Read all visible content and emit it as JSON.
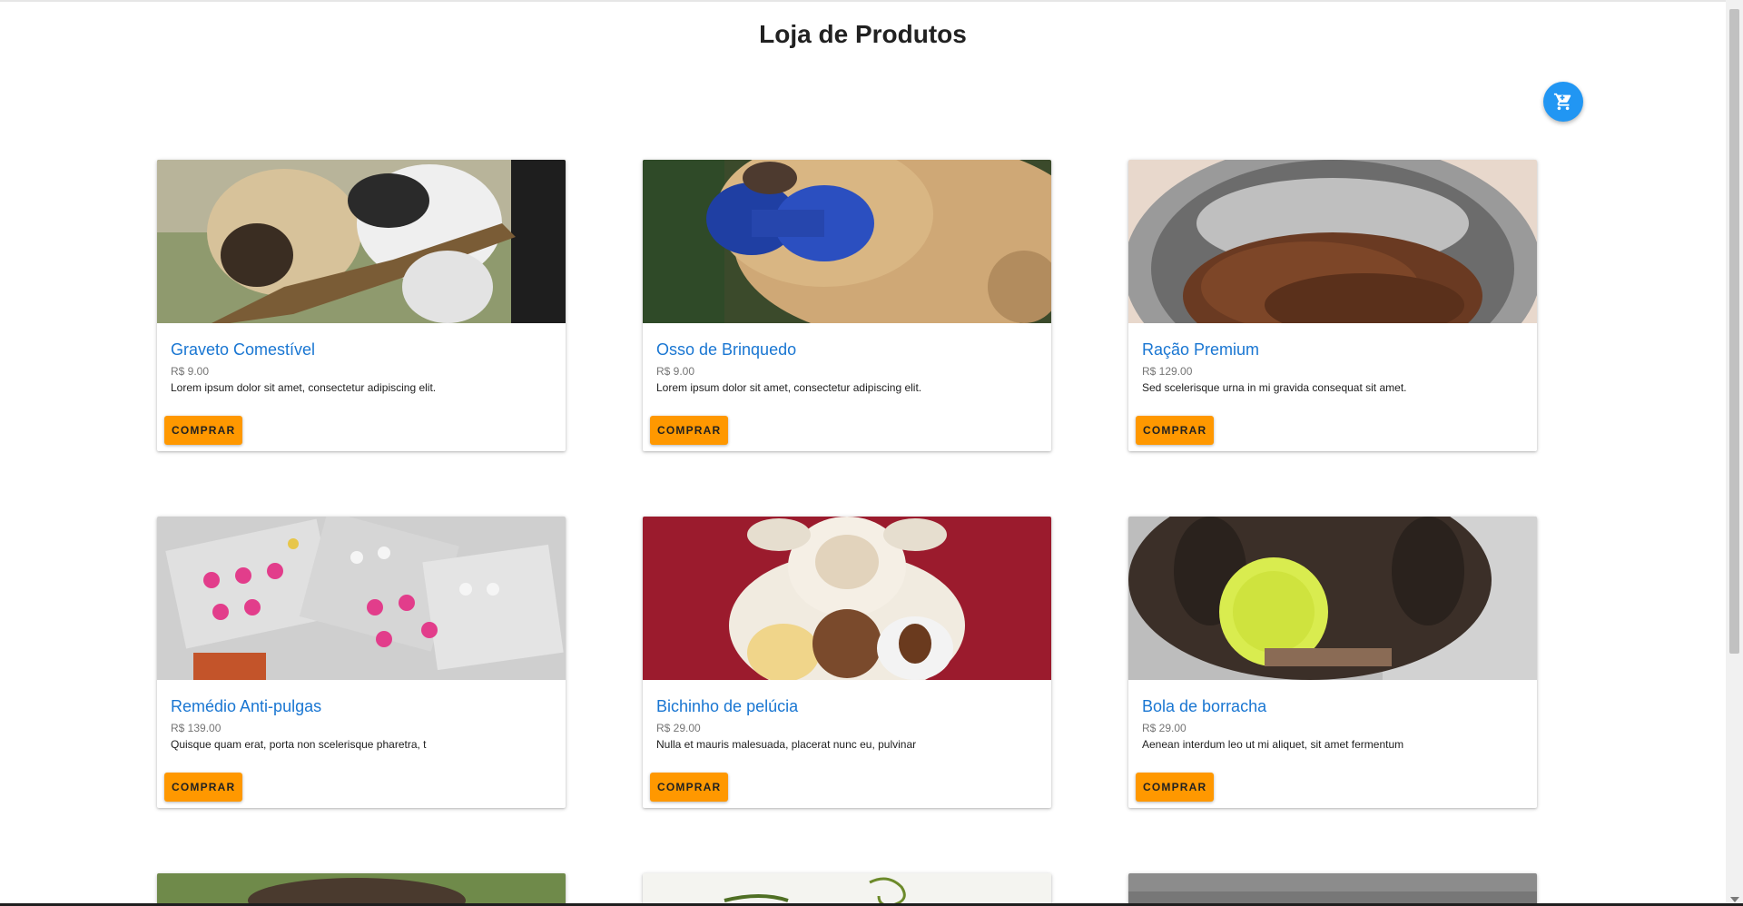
{
  "header": {
    "title": "Loja de Produtos"
  },
  "cart": {
    "icon": "shopping-cart-icon",
    "color": "#2196f3"
  },
  "colors": {
    "accent": "#ff9800",
    "title_link": "#1976d2"
  },
  "products": [
    {
      "name": "Graveto Comestível",
      "price": "R$ 9.00",
      "description": "Lorem ipsum dolor sit amet, consectetur adipiscing elit.",
      "button": "COMPRAR",
      "image": "two dogs chewing a stick"
    },
    {
      "name": "Osso de Brinquedo",
      "price": "R$ 9.00",
      "description": "Lorem ipsum dolor sit amet, consectetur adipiscing elit.",
      "button": "COMPRAR",
      "image": "dog with blue spiky toy"
    },
    {
      "name": "Ração Premium",
      "price": "R$ 129.00",
      "description": "Sed scelerisque urna in mi gravida consequat sit amet.",
      "button": "COMPRAR",
      "image": "steel bowl of kibble"
    },
    {
      "name": "Remédio Anti-pulgas",
      "price": "R$ 139.00",
      "description": "Quisque quam erat, porta non scelerisque pharetra, t",
      "button": "COMPRAR",
      "image": "blister packs of pills"
    },
    {
      "name": "Bichinho de pelúcia",
      "price": "R$ 29.00",
      "description": "Nulla et mauris malesuada, placerat nunc eu, pulvinar",
      "button": "COMPRAR",
      "image": "plush toys on red background"
    },
    {
      "name": "Bola de borracha",
      "price": "R$ 29.00",
      "description": "Aenean interdum leo ut mi aliquet, sit amet fermentum",
      "button": "COMPRAR",
      "image": "dog holding green spiky ball"
    }
  ]
}
